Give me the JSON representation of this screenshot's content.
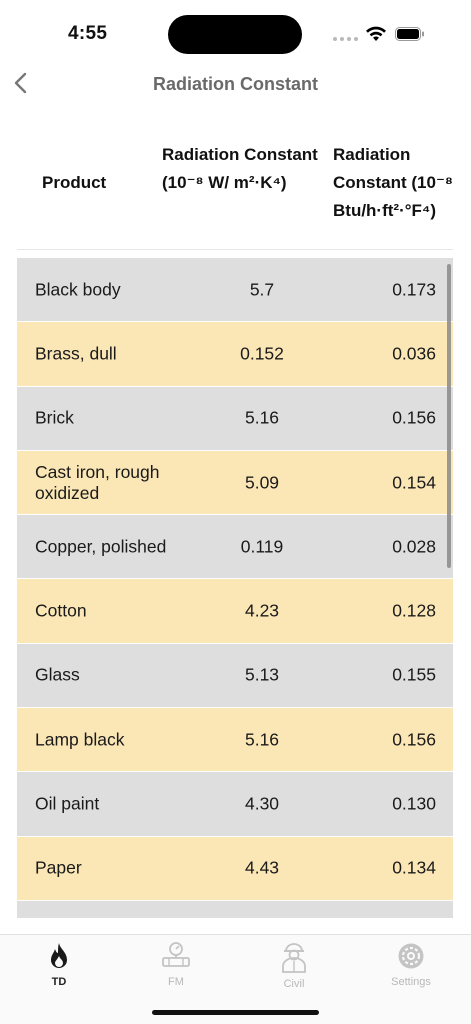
{
  "status_bar": {
    "time": "4:55"
  },
  "nav": {
    "title": "Radiation Constant"
  },
  "table": {
    "headers": {
      "product": "Product",
      "si": "Radiation Constant (10⁻⁸ W/ m²·K⁴)",
      "imperial": "Radiation Constant (10⁻⁸ Btu/h·ft²·°F⁴)"
    },
    "rows": [
      {
        "name": "Black body",
        "si": "5.7",
        "imperial": "0.173"
      },
      {
        "name": "Brass, dull",
        "si": "0.152",
        "imperial": "0.036"
      },
      {
        "name": "Brick",
        "si": "5.16",
        "imperial": "0.156"
      },
      {
        "name": "Cast iron, rough oxidized",
        "si": "5.09",
        "imperial": "0.154"
      },
      {
        "name": "Copper, polished",
        "si": "0.119",
        "imperial": "0.028"
      },
      {
        "name": "Cotton",
        "si": "4.23",
        "imperial": "0.128"
      },
      {
        "name": "Glass",
        "si": "5.13",
        "imperial": "0.155"
      },
      {
        "name": "Lamp black",
        "si": "5.16",
        "imperial": "0.156"
      },
      {
        "name": "Oil paint",
        "si": "4.30",
        "imperial": "0.130"
      },
      {
        "name": "Paper",
        "si": "4.43",
        "imperial": "0.134"
      },
      {
        "name": "",
        "si": "",
        "imperial": ""
      }
    ]
  },
  "tabs": [
    {
      "label": "TD",
      "icon": "flame-icon",
      "active": true
    },
    {
      "label": "FM",
      "icon": "pipe-gauge-icon",
      "active": false
    },
    {
      "label": "Civil",
      "icon": "worker-icon",
      "active": false
    },
    {
      "label": "Settings",
      "icon": "gear-icon",
      "active": false
    }
  ],
  "colors": {
    "row_gray": "#dedede",
    "row_yellow": "#fbe7b6",
    "title_gray": "#6a6a6a"
  }
}
